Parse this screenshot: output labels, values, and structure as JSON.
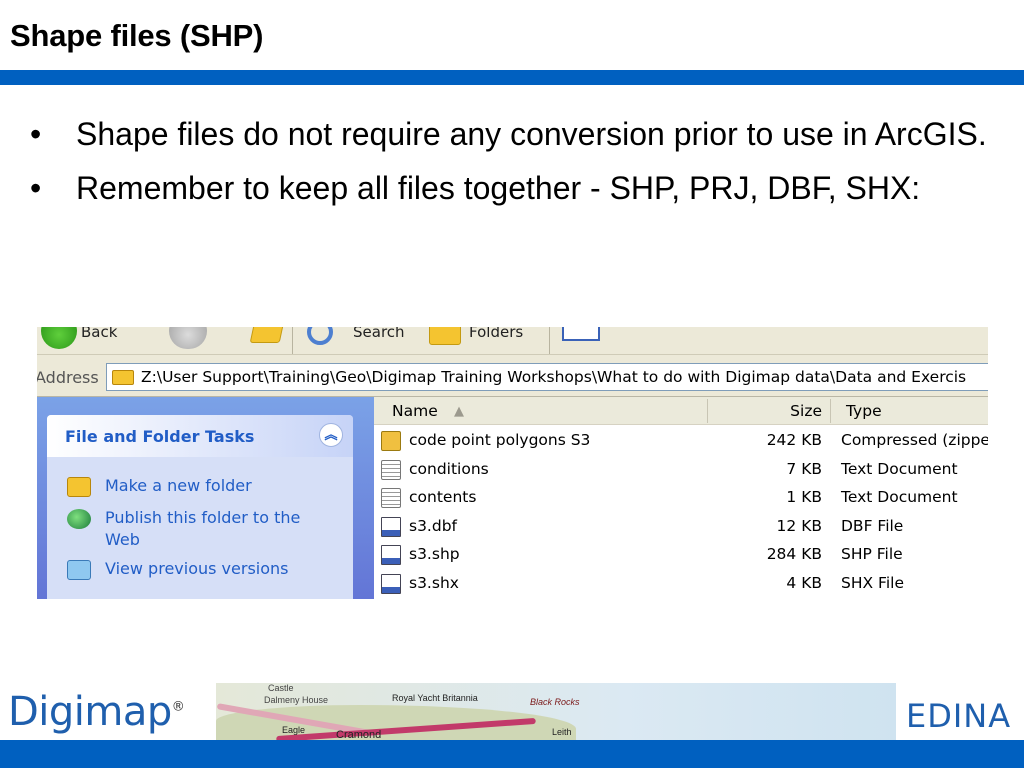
{
  "slide": {
    "title": "Shape files (SHP)",
    "bullets": [
      "Shape files do not require any conversion prior to use in ArcGIS.",
      "Remember to keep all files together - SHP, PRJ, DBF, SHX:"
    ]
  },
  "explorer": {
    "toolbar": {
      "back_label": "Back",
      "search_label": "Search",
      "folders_label": "Folders"
    },
    "address": {
      "label": "Address",
      "path": "Z:\\User Support\\Training\\Geo\\Digimap Training Workshops\\What to do with Digimap data\\Data and Exercis"
    },
    "tasks": {
      "title": "File and Folder Tasks",
      "items": [
        "Make a new folder",
        "Publish this folder to the Web",
        "View previous versions"
      ]
    },
    "columns": {
      "name": "Name",
      "size": "Size",
      "type": "Type"
    },
    "files": [
      {
        "name": "code point polygons S3",
        "size": "242 KB",
        "type": "Compressed (zippe",
        "icon": "zip-icon"
      },
      {
        "name": "conditions",
        "size": "7 KB",
        "type": "Text Document",
        "icon": "text-document-icon"
      },
      {
        "name": "contents",
        "size": "1 KB",
        "type": "Text Document",
        "icon": "text-document-icon"
      },
      {
        "name": "s3.dbf",
        "size": "12 KB",
        "type": "DBF File",
        "icon": "generic-file-icon"
      },
      {
        "name": "s3.shp",
        "size": "284 KB",
        "type": "SHP File",
        "icon": "generic-file-icon"
      },
      {
        "name": "s3.shx",
        "size": "4 KB",
        "type": "SHX File",
        "icon": "generic-file-icon"
      }
    ]
  },
  "footer": {
    "left_logo": "Digimap",
    "registered_mark": "®",
    "right_logo": "EDINA",
    "map_labels": {
      "castle": "Castle",
      "dalmeny": "Dalmeny House",
      "yacht": "Royal Yacht Britannia",
      "rocks": "Black Rocks",
      "eagle": "Eagle",
      "cramond": "Cramond",
      "leith": "Leith"
    }
  },
  "colors": {
    "accent_blue": "#0060c0",
    "xp_link_blue": "#215dc6"
  }
}
